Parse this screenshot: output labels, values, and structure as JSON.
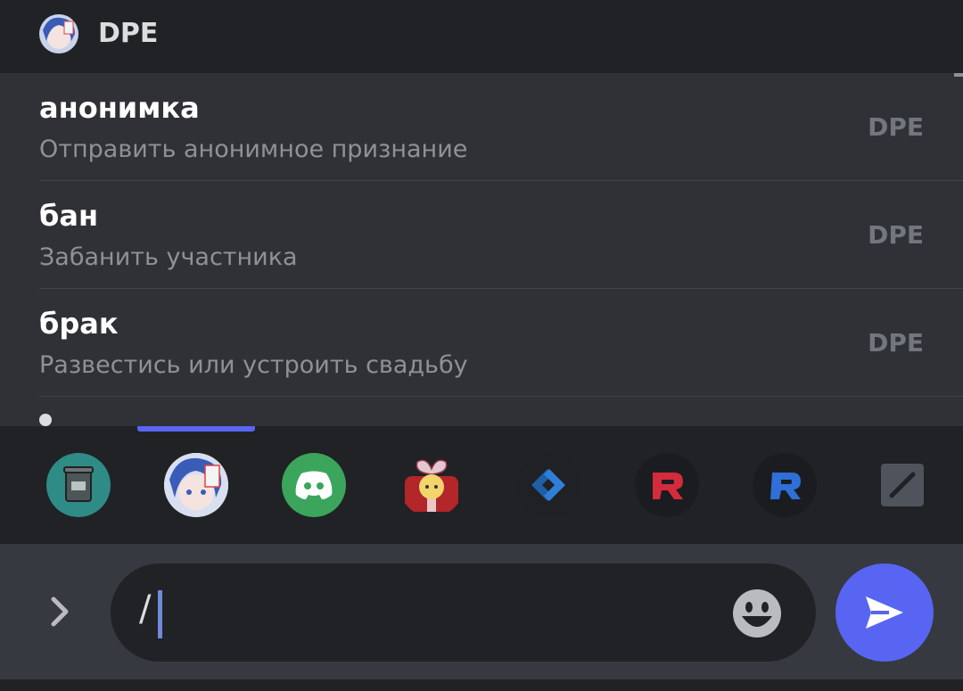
{
  "header": {
    "title": "DPE",
    "avatar_icon": "anime-girl-avatar"
  },
  "commands": [
    {
      "name": "анонимка",
      "description": "Отправить анонимное признание",
      "source": "DPE"
    },
    {
      "name": "бан",
      "description": "Забанить участника",
      "source": "DPE"
    },
    {
      "name": "брак",
      "description": "Развестись или устроить свадьбу",
      "source": "DPE"
    }
  ],
  "apps": [
    {
      "icon": "bucket-bot-icon",
      "color": "#2f8b85"
    },
    {
      "icon": "anime-girl-avatar",
      "color": "#8aa6d8"
    },
    {
      "icon": "discord-logo-icon",
      "color": "#3ba55c"
    },
    {
      "icon": "gift-character-icon",
      "color": "#b3262a"
    },
    {
      "icon": "blue-diamond-arrow-icon",
      "color": "#1f5fa8"
    },
    {
      "icon": "red-r-logo-icon",
      "color": "#d42b3c"
    },
    {
      "icon": "blue-r-logo-icon",
      "color": "#2f6fd8"
    },
    {
      "icon": "slash-commands-icon",
      "color": "#4f545c"
    }
  ],
  "compose": {
    "input_value": "/",
    "emoji_icon": "grinning-face-icon",
    "send_icon": "send-arrow-icon"
  },
  "colors": {
    "accent": "#5865f2",
    "background": "#2f3136",
    "header": "#202225"
  }
}
